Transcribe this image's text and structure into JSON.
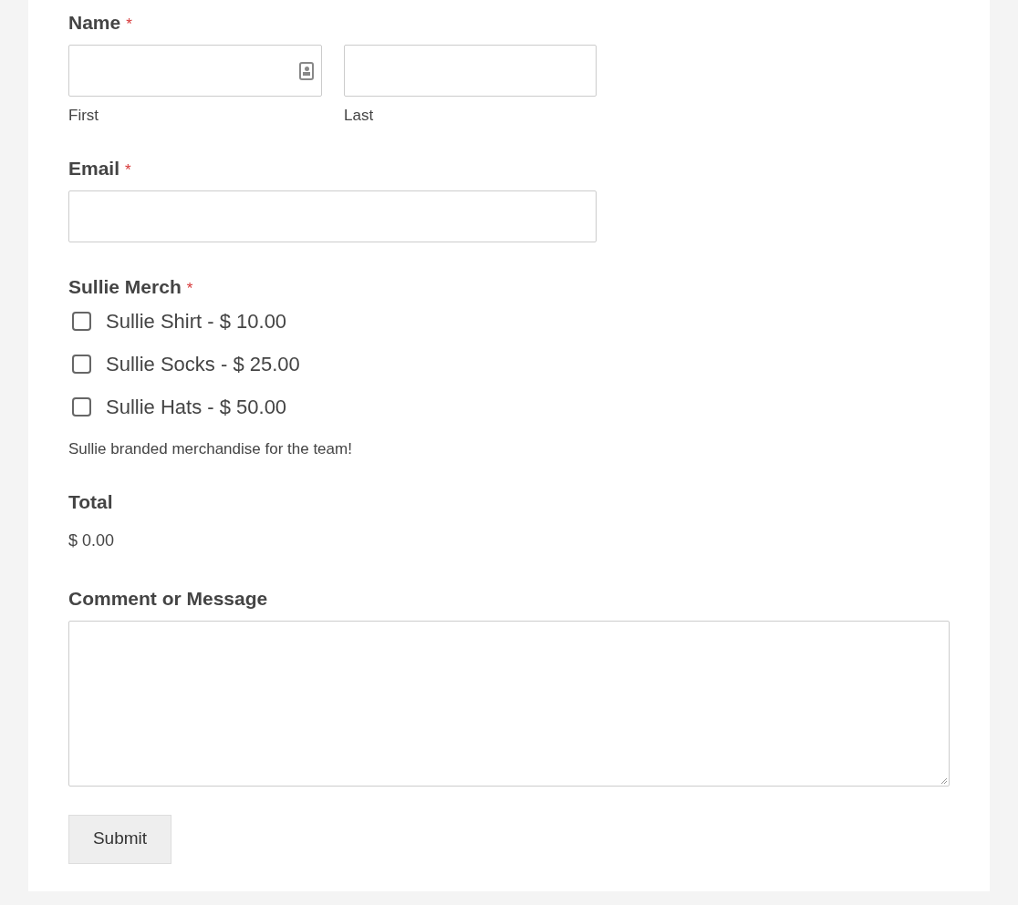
{
  "name_field": {
    "label": "Name",
    "required_mark": "*",
    "subfields": [
      {
        "sublabel": "First",
        "autofill_icon": true
      },
      {
        "sublabel": "Last"
      }
    ]
  },
  "email_field": {
    "label": "Email",
    "required_mark": "*"
  },
  "merch_field": {
    "label": "Sullie Merch",
    "required_mark": "*",
    "options": [
      {
        "label": "Sullie Shirt - $ 10.00",
        "checked": false
      },
      {
        "label": "Sullie Socks - $ 25.00",
        "checked": false
      },
      {
        "label": "Sullie Hats - $ 50.00",
        "checked": false
      }
    ],
    "description": "Sullie branded merchandise for the team!"
  },
  "total_field": {
    "label": "Total",
    "value": "$ 0.00"
  },
  "comment_field": {
    "label": "Comment or Message"
  },
  "submit_button": "Submit"
}
